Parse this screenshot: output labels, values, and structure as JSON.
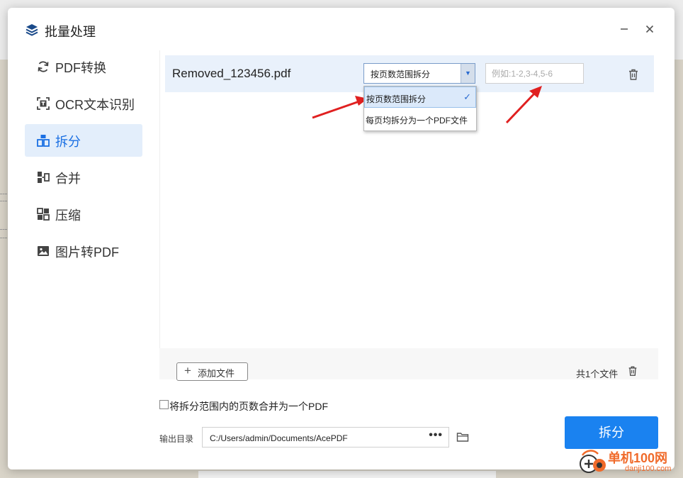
{
  "dialog": {
    "title": "批量处理",
    "minimize_icon": "minimize-icon",
    "close_icon": "close-icon"
  },
  "sidebar": {
    "items": [
      {
        "label": "PDF转换",
        "icon": "convert-icon",
        "active": false
      },
      {
        "label": "OCR文本识别",
        "icon": "ocr-icon",
        "active": false
      },
      {
        "label": "拆分",
        "icon": "split-icon",
        "active": true
      },
      {
        "label": "合并",
        "icon": "merge-icon",
        "active": false
      },
      {
        "label": "压缩",
        "icon": "compress-icon",
        "active": false
      },
      {
        "label": "图片转PDF",
        "icon": "image-to-pdf-icon",
        "active": false
      }
    ]
  },
  "file_list": {
    "files": [
      {
        "name": "Removed_123456.pdf",
        "split_mode": "按页数范围拆分",
        "range_placeholder": "例如:1-2,3-4,5-6"
      }
    ],
    "dropdown_options": [
      {
        "label": "按页数范围拆分",
        "selected": true
      },
      {
        "label": "每页均拆分为一个PDF文件",
        "selected": false
      }
    ]
  },
  "footer": {
    "add_file_label": "添加文件",
    "file_count": "共1个文件"
  },
  "options": {
    "merge_label": "将拆分范围内的页数合并为一个PDF",
    "merge_checked": false
  },
  "output": {
    "label": "输出目录",
    "path": "C:/Users/admin/Documents/AcePDF",
    "browse_label": "•••"
  },
  "actions": {
    "split_label": "拆分"
  },
  "colors": {
    "accent": "#1a82f0",
    "active_nav_bg": "#e3eefb",
    "annotation_arrow": "#e02020"
  },
  "watermark": {
    "title": "单机100网",
    "url": "danji100.com"
  }
}
